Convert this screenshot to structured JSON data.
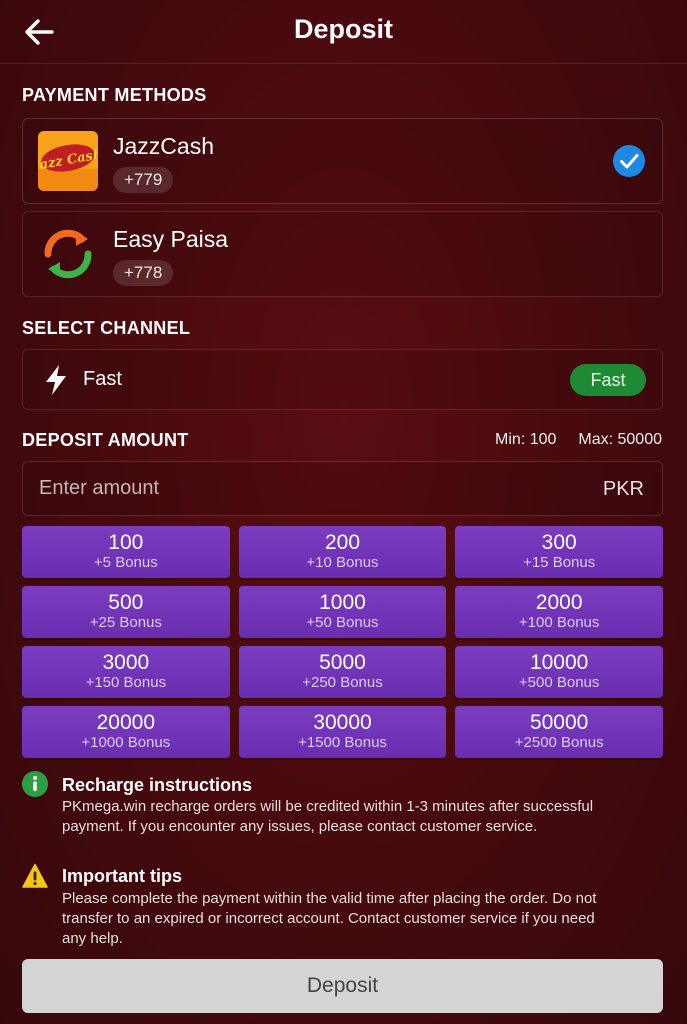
{
  "header": {
    "title": "Deposit"
  },
  "payment": {
    "section_title": "PAYMENT METHODS",
    "methods": [
      {
        "name": "JazzCash",
        "badge": "+779",
        "logo_text": "Jazz Cash",
        "selected": true
      },
      {
        "name": "Easy Paisa",
        "badge": "+778",
        "selected": false
      }
    ]
  },
  "channel": {
    "section_title": "SELECT CHANNEL",
    "label": "Fast",
    "pill": "Fast"
  },
  "amount": {
    "section_title": "DEPOSIT AMOUNT",
    "min": "Min: 100",
    "max": "Max: 50000",
    "placeholder": "Enter amount",
    "currency": "PKR",
    "presets": [
      {
        "amount": "100",
        "bonus": "+5 Bonus"
      },
      {
        "amount": "200",
        "bonus": "+10 Bonus"
      },
      {
        "amount": "300",
        "bonus": "+15 Bonus"
      },
      {
        "amount": "500",
        "bonus": "+25 Bonus"
      },
      {
        "amount": "1000",
        "bonus": "+50 Bonus"
      },
      {
        "amount": "2000",
        "bonus": "+100 Bonus"
      },
      {
        "amount": "3000",
        "bonus": "+150 Bonus"
      },
      {
        "amount": "5000",
        "bonus": "+250 Bonus"
      },
      {
        "amount": "10000",
        "bonus": "+500 Bonus"
      },
      {
        "amount": "20000",
        "bonus": "+1000 Bonus"
      },
      {
        "amount": "30000",
        "bonus": "+1500 Bonus"
      },
      {
        "amount": "50000",
        "bonus": "+2500 Bonus"
      }
    ]
  },
  "instructions": {
    "title": "Recharge instructions",
    "body": "PKmega.win recharge orders will be credited within 1-3 minutes after successful payment. If you encounter any issues, please contact customer service."
  },
  "tips": {
    "title": "Important tips",
    "body": "Please complete the payment within the valid time after placing the order. Do not transfer to an expired or incorrect account. Contact customer service if you need any help."
  },
  "deposit_button": "Deposit",
  "colors": {
    "background": "#450a0e",
    "preset_purple": "#7b3cc0",
    "check_blue": "#1e88e5",
    "fast_green": "#1f8a36",
    "info_green": "#2e9e44",
    "warning_yellow": "#f5c518",
    "button_gray": "#d4d4d4"
  }
}
